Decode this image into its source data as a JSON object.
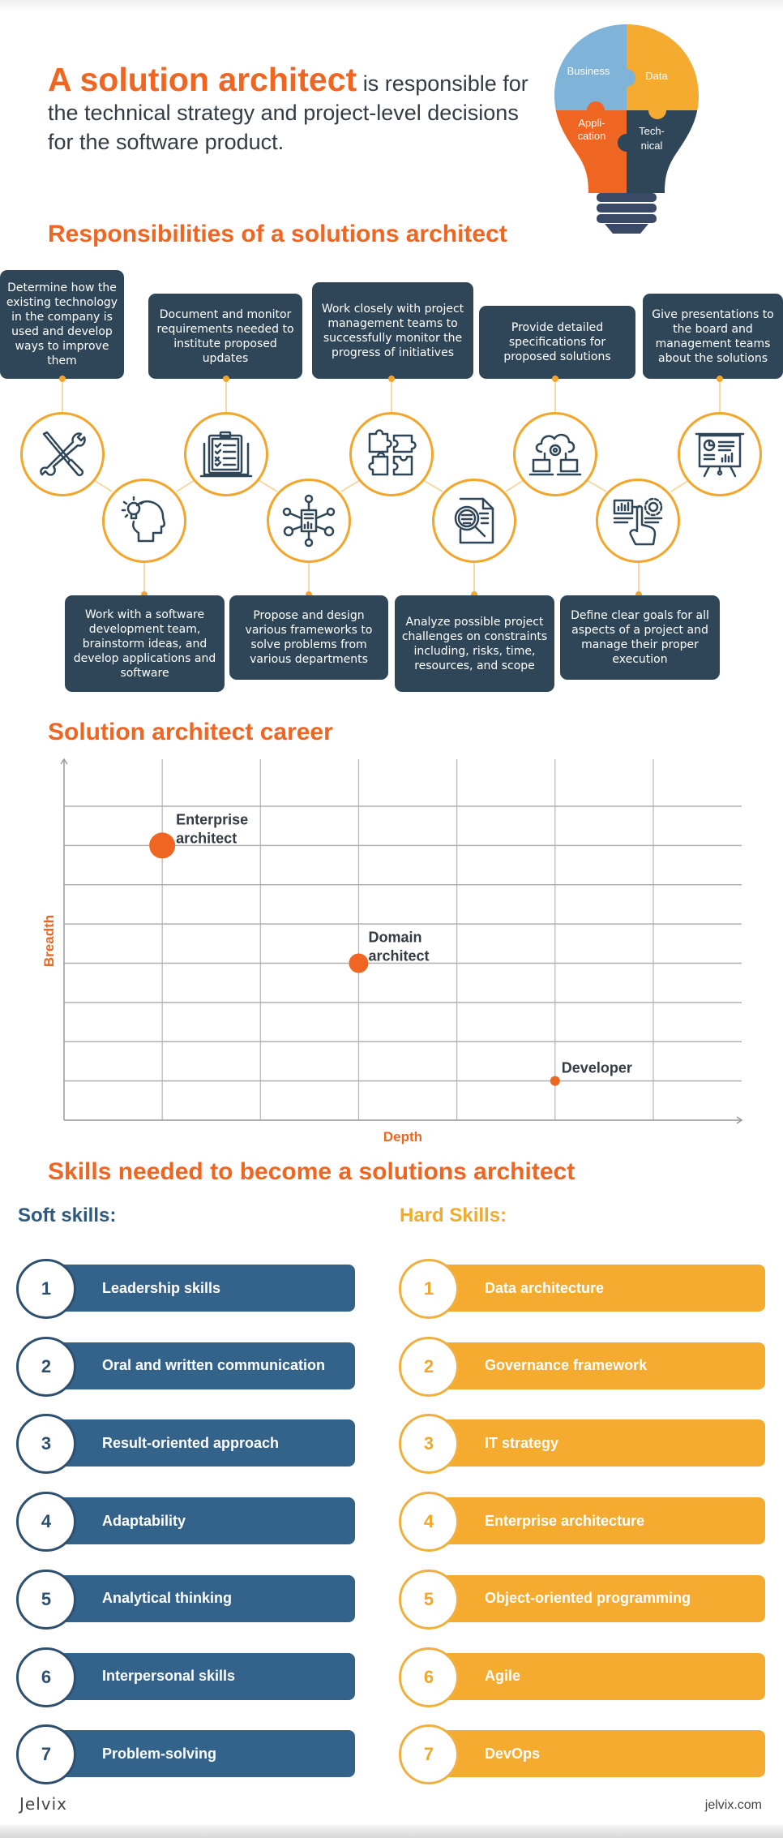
{
  "intro": {
    "highlight": "A solution architect",
    "text": " is responsible for the technical strategy and project-level decisions for the software product."
  },
  "bulb": {
    "pieces": [
      {
        "label": "Business",
        "color": "#7fb3d8"
      },
      {
        "label": "Data",
        "color": "#f5ab30"
      },
      {
        "label_lines": [
          "Appli-",
          "cation"
        ],
        "color": "#ef6623"
      },
      {
        "label_lines": [
          "Tech-",
          "nical"
        ],
        "color": "#2f4658"
      }
    ],
    "base_color": "#3a4a66"
  },
  "responsibilities": {
    "title": "Responsibilities of a solutions architect",
    "top": [
      {
        "text": "Determine how the existing technology in the company is used and develop ways to improve them",
        "icon": "tools-icon"
      },
      {
        "text": "Document and monitor requirements needed to institute proposed updates",
        "icon": "clipboard-checklist-icon"
      },
      {
        "text": "Work closely with project management teams to successfully monitor the progress of initiatives",
        "icon": "puzzle-pieces-icon"
      },
      {
        "text": "Provide detailed specifications for proposed solutions",
        "icon": "cloud-network-icon"
      },
      {
        "text": "Give presentations to the board and management teams about the solutions",
        "icon": "presentation-board-icon"
      }
    ],
    "bottom": [
      {
        "text": "Work with a software development team, brainstorm ideas, and develop applications and software",
        "icon": "head-lightbulb-icon"
      },
      {
        "text": "Propose and design various frameworks to solve problems from various departments",
        "icon": "network-document-icon"
      },
      {
        "text": "Analyze possible project challenges on constraints including, risks, time, resources, and scope",
        "icon": "document-magnifier-icon"
      },
      {
        "text": "Define clear goals for all aspects of a project and manage their proper execution",
        "icon": "hand-touch-dashboard-icon"
      }
    ]
  },
  "career": {
    "title": "Solution architect career"
  },
  "chart_data": {
    "type": "scatter",
    "title": "Solution architect career",
    "xlabel": "Depth",
    "ylabel": "Breadth",
    "xlim": [
      0,
      6.9
    ],
    "ylim": [
      0,
      9.2
    ],
    "x_gridlines": [
      1,
      2,
      3,
      4,
      5,
      6
    ],
    "y_gridlines": [
      1,
      2,
      3,
      4,
      5,
      6,
      7,
      8
    ],
    "grid": true,
    "tick_labels": false,
    "points": [
      {
        "label": "Enterprise architect",
        "label_lines": [
          "Enterprise",
          "architect"
        ],
        "x": 1,
        "y": 7,
        "size": "large"
      },
      {
        "label": "Domain architect",
        "label_lines": [
          "Domain",
          "architect"
        ],
        "x": 3,
        "y": 4,
        "size": "medium"
      },
      {
        "label": "Developer",
        "label_lines": [
          "Developer"
        ],
        "x": 5,
        "y": 1,
        "size": "small"
      }
    ],
    "point_color": "#ef6623"
  },
  "skills": {
    "title": "Skills needed to become a solutions architect",
    "soft": {
      "heading": "Soft skills:",
      "items": [
        {
          "num": "1",
          "label": "Leadership skills"
        },
        {
          "num": "2",
          "label": "Oral and written communication"
        },
        {
          "num": "3",
          "label": "Result-oriented approach"
        },
        {
          "num": "4",
          "label": "Adaptability"
        },
        {
          "num": "5",
          "label": "Analytical thinking"
        },
        {
          "num": "6",
          "label": "Interpersonal skills"
        },
        {
          "num": "7",
          "label": "Problem-solving"
        }
      ]
    },
    "hard": {
      "heading": "Hard Skills:",
      "items": [
        {
          "num": "1",
          "label": "Data architecture"
        },
        {
          "num": "2",
          "label": "Governance framework"
        },
        {
          "num": "3",
          "label": "IT strategy"
        },
        {
          "num": "4",
          "label": "Enterprise architecture"
        },
        {
          "num": "5",
          "label": "Object-oriented programming"
        },
        {
          "num": "6",
          "label": "Agile"
        },
        {
          "num": "7",
          "label": "DevOps"
        }
      ]
    }
  },
  "footer": {
    "logo": "Jelvix",
    "url": "jelvix.com"
  },
  "colors": {
    "accent_orange": "#ef6623",
    "accent_yellow": "#f3a62c",
    "dark_navy": "#2f4658",
    "soft_blue": "#33628a"
  }
}
